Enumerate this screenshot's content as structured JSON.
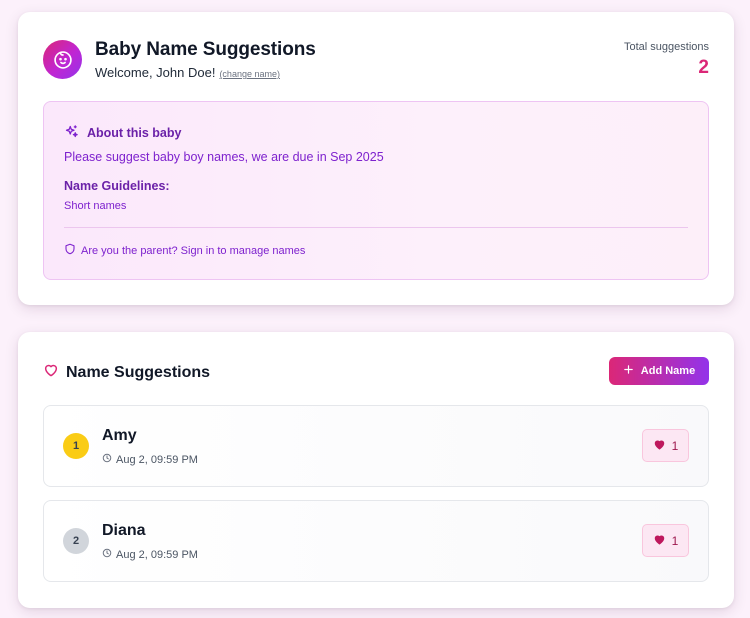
{
  "header": {
    "title": "Baby Name Suggestions",
    "welcome": "Welcome, John Doe!",
    "change_name": "(change name)",
    "total_label": "Total suggestions",
    "total_count": "2"
  },
  "about": {
    "heading": "About this baby",
    "description": "Please suggest baby boy names, we are due in Sep 2025",
    "guidelines_heading": "Name Guidelines:",
    "guidelines_text": "Short names",
    "parent_link": "Are you the parent? Sign in to manage names"
  },
  "suggestions": {
    "heading": "Name Suggestions",
    "add_label": "Add Name",
    "items": [
      {
        "rank": "1",
        "name": "Amy",
        "time": "Aug 2, 09:59 PM",
        "likes": "1"
      },
      {
        "rank": "2",
        "name": "Diana",
        "time": "Aug 2, 09:59 PM",
        "likes": "1"
      }
    ]
  },
  "colors": {
    "accent_pink": "#db2777",
    "accent_purple": "#9333ea",
    "page_bg": "#fcf1fb",
    "rank_gold": "#facc15",
    "rank_silver": "#d1d5db"
  },
  "icons": {
    "avatar": "baby-face-icon",
    "about": "sparkles-icon",
    "parent": "shield-icon",
    "suggestions": "heart-outline-icon",
    "add": "plus-icon",
    "time": "clock-icon",
    "like": "heart-filled-icon"
  }
}
